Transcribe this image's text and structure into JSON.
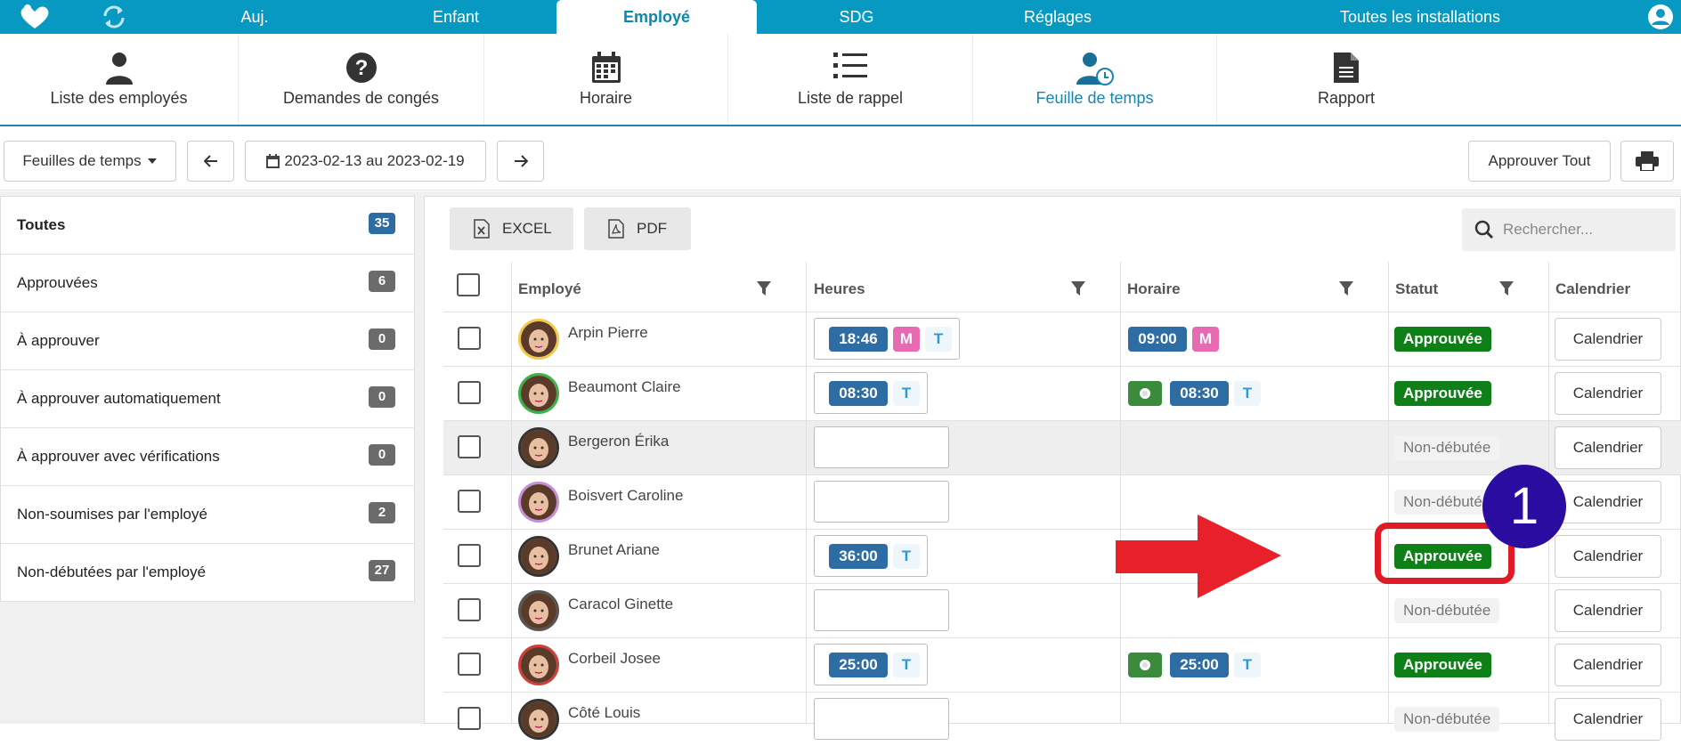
{
  "topnav": {
    "tabs": [
      "Auj.",
      "Enfant",
      "Employé",
      "SDG",
      "Réglages",
      "Toutes les installations"
    ],
    "active_index": 2
  },
  "subnav": {
    "items": [
      "Liste des employés",
      "Demandes de congés",
      "Horaire",
      "Liste de rappel",
      "Feuille de temps",
      "Rapport"
    ],
    "active_index": 4
  },
  "toolbar": {
    "view_select": "Feuilles de temps",
    "date_range": "2023-02-13 au 2023-02-19",
    "approve_all": "Approuver Tout"
  },
  "filters": [
    {
      "label": "Toutes",
      "count": "35",
      "bold": true
    },
    {
      "label": "Approuvées",
      "count": "6"
    },
    {
      "label": "À approuver",
      "count": "0"
    },
    {
      "label": "À approuver automatiquement",
      "count": "0"
    },
    {
      "label": "À approuver avec vérifications",
      "count": "0"
    },
    {
      "label": "Non-soumises par l'employé",
      "count": "2"
    },
    {
      "label": "Non-débutées par l'employé",
      "count": "27"
    }
  ],
  "export": {
    "excel": "EXCEL",
    "pdf": "PDF"
  },
  "search": {
    "placeholder": "Rechercher..."
  },
  "table": {
    "headers": {
      "employee": "Employé",
      "hours": "Heures",
      "schedule": "Horaire",
      "status": "Statut",
      "calendar": "Calendrier"
    },
    "rows": [
      {
        "name": "Arpin Pierre",
        "hours": "18:46",
        "hours_tags": [
          "M",
          "T"
        ],
        "sched": "09:00",
        "sched_tags": [
          "M"
        ],
        "sched_toggle": false,
        "status": "Approuvée",
        "approved": true,
        "avatar_border": "#f2c94c"
      },
      {
        "name": "Beaumont Claire",
        "hours": "08:30",
        "hours_tags": [
          "T"
        ],
        "sched": "08:30",
        "sched_tags": [
          "T"
        ],
        "sched_toggle": true,
        "status": "Approuvée",
        "approved": true,
        "avatar_border": "#3cb34a"
      },
      {
        "name": "Bergeron Érika",
        "hours": "",
        "status": "Non-débutée",
        "approved": false,
        "avatar_border": "#333333",
        "highlight": true
      },
      {
        "name": "Boisvert Caroline",
        "hours": "",
        "status": "Non-débutée",
        "approved": false,
        "avatar_border": "#c48fd8"
      },
      {
        "name": "Brunet Ariane",
        "hours": "36:00",
        "hours_tags": [
          "T"
        ],
        "status": "Approuvée",
        "approved": true,
        "avatar_border": "#333333"
      },
      {
        "name": "Caracol Ginette",
        "hours": "",
        "status": "Non-débutée",
        "approved": false,
        "avatar_border": "#555555"
      },
      {
        "name": "Corbeil Josee",
        "hours": "25:00",
        "hours_tags": [
          "T"
        ],
        "sched": "25:00",
        "sched_tags": [
          "T"
        ],
        "sched_toggle": true,
        "status": "Approuvée",
        "approved": true,
        "avatar_border": "#d33c3c"
      },
      {
        "name": "Côté Louis",
        "hours": "",
        "status": "Non-débutée",
        "approved": false,
        "avatar_border": "#333333"
      }
    ],
    "calendar_label": "Calendrier"
  },
  "annotation": {
    "number": "1"
  },
  "colors": {
    "nav": "#0799c2",
    "approved": "#0f7f18",
    "badge": "#6b6b6b",
    "badge_active": "#2e6da4",
    "arrow": "#e8202a",
    "circle": "#2a0ca0"
  }
}
